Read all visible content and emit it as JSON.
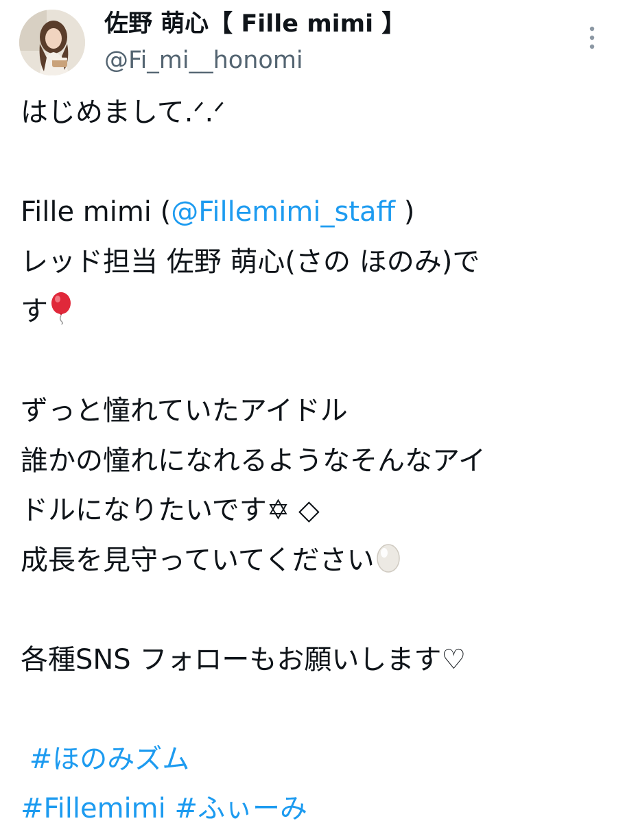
{
  "user": {
    "display_name": "佐野 萌心【 Fille mimi 】",
    "handle": "@Fi_mi__honomi"
  },
  "icons": {
    "more": "more-vertical-icon",
    "balloon": "red-balloon-emoji",
    "egg": "egg-emoji"
  },
  "colors": {
    "link": "#1d9bf0",
    "text": "#0f1419",
    "secondary": "#536471"
  },
  "tweet": {
    "line1": "はじめまして.ᐟ.ᐟ",
    "line2_pre": "Fille mimi (",
    "line2_mention": "@Fillemimi_staff",
    "line2_post": " )",
    "line3": "レッド担当 佐野 萌心(さの ほのみ)で",
    "line4": "す",
    "line5": "ずっと憧れていたアイドル",
    "line6": "誰かの憧れになれるようなそんなアイ",
    "line7": "ドルになりたいです✡︎ ◇",
    "line8": "成長を見守っていてください",
    "line9": "各種SNS フォローもお願いします♡",
    "hashtag1": "#ほのみズム",
    "hashtag2": "#Fillemimi",
    "hashtag3": "#ふぃーみ"
  }
}
